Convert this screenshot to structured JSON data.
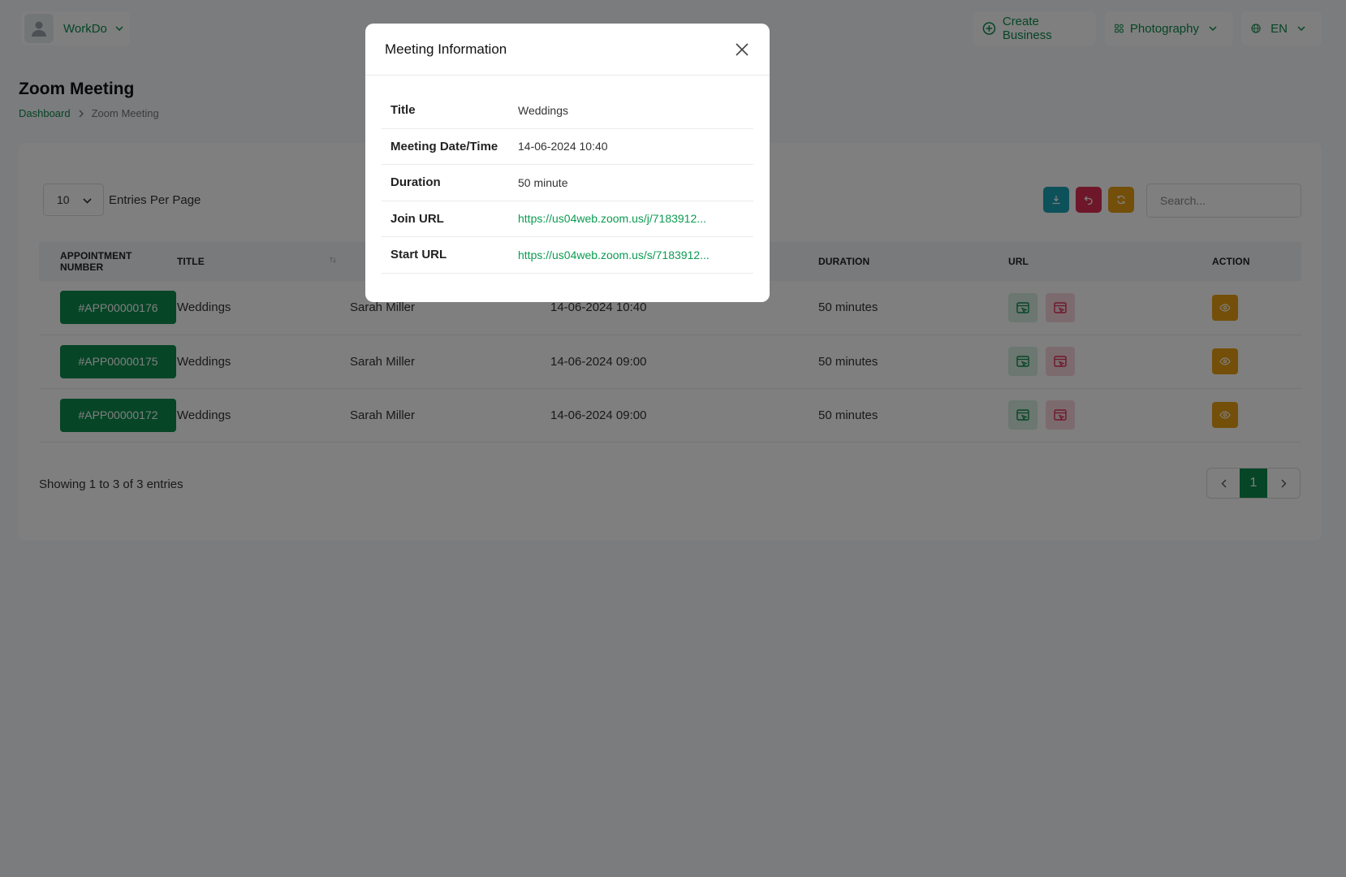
{
  "topbar": {
    "user_name": "WorkDo",
    "create_business_label": "Create Business",
    "business_label": "Photography",
    "language_label": "EN"
  },
  "page": {
    "title": "Zoom Meeting",
    "breadcrumb": [
      "Dashboard",
      "Zoom Meeting"
    ]
  },
  "table_controls": {
    "per_page_value": "10",
    "per_page_label": "Entries Per Page",
    "search_placeholder": "Search..."
  },
  "columns": [
    "Appointment Number",
    "Title",
    "",
    "",
    "Duration",
    "URL",
    "Action"
  ],
  "rows": [
    {
      "number": "#APP00000176",
      "title": "Weddings",
      "user": "Sarah Miller",
      "datetime": "14-06-2024 10:40",
      "duration": "50 minutes"
    },
    {
      "number": "#APP00000175",
      "title": "Weddings",
      "user": "Sarah Miller",
      "datetime": "14-06-2024 09:00",
      "duration": "50 minutes"
    },
    {
      "number": "#APP00000172",
      "title": "Weddings",
      "user": "Sarah Miller",
      "datetime": "14-06-2024 09:00",
      "duration": "50 minutes"
    }
  ],
  "footer": {
    "showing": "Showing 1 to 3 of 3 entries",
    "current_page": "1"
  },
  "modal": {
    "title": "Meeting Information",
    "fields": [
      {
        "label": "Title",
        "value": "Weddings"
      },
      {
        "label": "Meeting Date/Time",
        "value": "14-06-2024 10:40"
      },
      {
        "label": "Duration",
        "value": "50 minute"
      },
      {
        "label": "Join URL",
        "value": "https://us04web.zoom.us/j/7183912..."
      },
      {
        "label": "Start URL",
        "value": "https://us04web.zoom.us/s/7183912..."
      }
    ]
  },
  "colors": {
    "brand": "#0c8b4c",
    "export": "#1aa3b5",
    "reset": "#dc2f54",
    "refresh": "#e89e12"
  },
  "icons": [
    "user-icon",
    "chevron-down-icon",
    "plus-circle-icon",
    "grid-icon",
    "globe-icon",
    "chevron-right-icon",
    "download-icon",
    "undo-icon",
    "refresh-icon",
    "sort-icon",
    "join-window-icon",
    "start-window-icon",
    "eye-icon",
    "chevron-left-icon",
    "close-icon"
  ]
}
